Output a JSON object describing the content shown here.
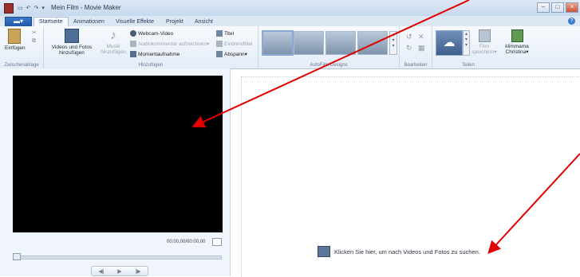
{
  "window": {
    "title": "Mein Film - Movie Maker"
  },
  "tabs": [
    "Startseite",
    "Animationen",
    "Visuelle Effekte",
    "Projekt",
    "Ansicht"
  ],
  "ribbon": {
    "clipboard": {
      "paste": "Einfügen",
      "label": "Zwischenablage"
    },
    "add": {
      "videos_fotos": "Videos und Fotos hinzufügen",
      "musik": "Musik hinzufügen",
      "webcam": "Webcam-Video",
      "audiokommentar": "Audiokommentar aufzeichnen",
      "momentaufnahme": "Momentaufnahme",
      "titel": "Titel",
      "beschriftung": "Einblendtitel",
      "abspann": "Abspann",
      "label": "Hinzufügen"
    },
    "autofilm": {
      "label": "AutoFilm-Designs"
    },
    "edit": {
      "label": "Bearbeiten"
    },
    "share": {
      "film_speichern": "Film speichern",
      "user": "klimmama Christina",
      "label": "Teilen"
    }
  },
  "preview": {
    "timecode": "00:00,00/00:00,00"
  },
  "storyboard": {
    "hint": "Klicken Sie hier, um nach Videos und Fotos zu suchen."
  },
  "colors": {
    "annotation_arrow": "#e00000",
    "preview_bg": "#000000",
    "accent": "#2b5fad"
  }
}
